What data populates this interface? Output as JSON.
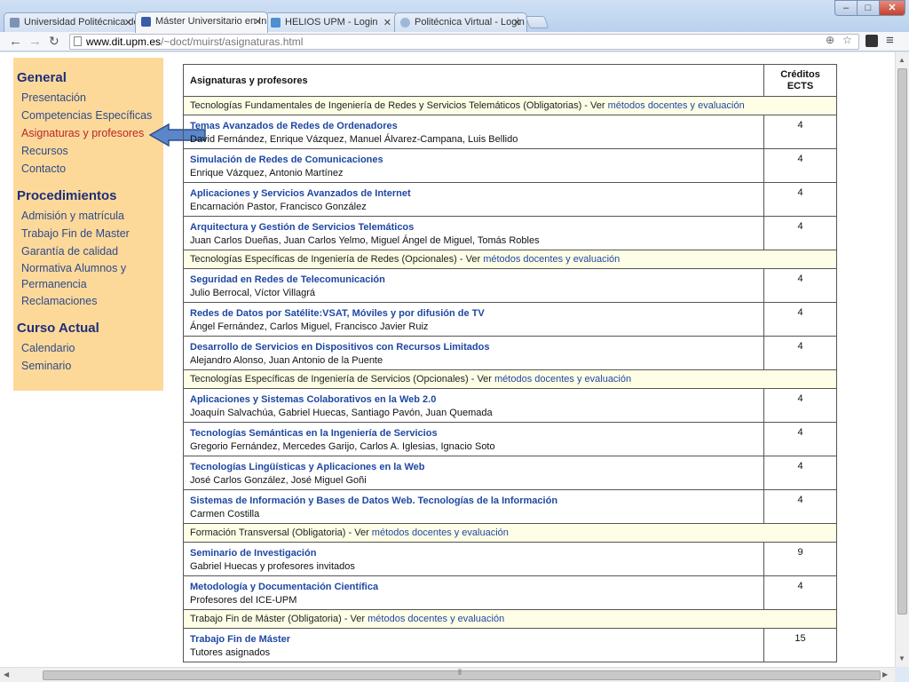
{
  "browser": {
    "tabs": [
      {
        "label": "Universidad Politécnica de",
        "active": false
      },
      {
        "label": "Máster Universitario en In",
        "active": true
      },
      {
        "label": "HELIOS UPM - Login",
        "active": false
      },
      {
        "label": "Politécnica Virtual - Login",
        "active": false
      }
    ],
    "url_host": "www.dit.upm.es",
    "url_path": "/~doct/muirst/asignaturas.html",
    "window_buttons": {
      "minimize": "–",
      "maximize": "□",
      "close": "✕"
    }
  },
  "sidebar": {
    "sections": [
      {
        "heading": "General",
        "items": [
          "Presentación",
          "Competencias Específicas",
          "Asignaturas y profesores",
          "Recursos",
          "Contacto"
        ]
      },
      {
        "heading": "Procedimientos",
        "items": [
          "Admisión y matrícula",
          "Trabajo Fin de Master",
          "Garantía de calidad",
          "Normativa Alumnos y Permanencia",
          "Reclamaciones"
        ]
      },
      {
        "heading": "Curso Actual",
        "items": [
          "Calendario",
          "Seminario"
        ]
      }
    ],
    "current_item": "Asignaturas y profesores"
  },
  "table": {
    "header_subjects": "Asignaturas y profesores",
    "header_credits_line1": "Créditos",
    "header_credits_line2": "ECTS",
    "sections": [
      {
        "title": "Tecnologías Fundamentales de Ingeniería de Redes y Servicios Telemáticos (Obligatorias) - Ver ",
        "link": "métodos docentes y evaluación",
        "courses": [
          {
            "name": "Temas Avanzados de Redes de Ordenadores",
            "profs": "David Fernández, Enrique Vázquez, Manuel Álvarez-Campana, Luis Bellido",
            "credits": "4"
          },
          {
            "name": "Simulación de Redes de Comunicaciones",
            "profs": "Enrique Vázquez, Antonio Martínez",
            "credits": "4"
          },
          {
            "name": "Aplicaciones y Servicios Avanzados de Internet",
            "profs": "Encarnación Pastor, Francisco González",
            "credits": "4"
          },
          {
            "name": "Arquitectura y Gestión de Servicios Telemáticos",
            "profs": "Juan Carlos Dueñas, Juan Carlos Yelmo, Miguel Ángel de Miguel, Tomás Robles",
            "credits": "4"
          }
        ]
      },
      {
        "title": "Tecnologías Específicas de Ingeniería de Redes (Opcionales) - Ver ",
        "link": "métodos docentes y evaluación",
        "courses": [
          {
            "name": "Seguridad en Redes de Telecomunicación",
            "profs": "Julio Berrocal, Víctor Villagrá",
            "credits": "4"
          },
          {
            "name": "Redes de Datos por Satélite:VSAT, Móviles y por difusión de TV",
            "profs": "Ángel Fernández, Carlos Miguel, Francisco Javier Ruiz",
            "credits": "4"
          },
          {
            "name": "Desarrollo de Servicios en Dispositivos con Recursos Limitados",
            "profs": "Alejandro Alonso, Juan Antonio de la Puente",
            "credits": "4"
          }
        ]
      },
      {
        "title": "Tecnologías Específicas de Ingeniería de Servicios (Opcionales) - Ver ",
        "link": "métodos docentes y evaluación",
        "courses": [
          {
            "name": "Aplicaciones y Sistemas Colaborativos en la Web 2.0",
            "profs": "Joaquín Salvachúa, Gabriel Huecas, Santiago Pavón, Juan Quemada",
            "credits": "4"
          },
          {
            "name": "Tecnologías Semánticas en la Ingeniería de Servicios",
            "profs": "Gregorio Fernández, Mercedes Garijo, Carlos A. Iglesias, Ignacio Soto",
            "credits": "4"
          },
          {
            "name": "Tecnologías Lingüísticas y Aplicaciones en la Web",
            "profs": "José Carlos González, José Miguel Goñi",
            "credits": "4"
          },
          {
            "name": "Sistemas de Información y Bases de Datos Web. Tecnologías de la Información",
            "profs": "Carmen Costilla",
            "credits": "4"
          }
        ]
      },
      {
        "title": "Formación Transversal (Obligatoria) - Ver ",
        "link": "métodos docentes y evaluación",
        "courses": [
          {
            "name": "Seminario de Investigación",
            "profs": "Gabriel Huecas y profesores invitados",
            "credits": "9"
          },
          {
            "name": "Metodología y Documentación Científica",
            "profs": "Profesores del ICE-UPM",
            "credits": "4"
          }
        ]
      },
      {
        "title": "Trabajo Fin de Máster (Obligatoria) - Ver ",
        "link": "métodos docentes y evaluación",
        "courses": [
          {
            "name": "Trabajo Fin de Máster",
            "profs": "Tutores asignados",
            "credits": "15"
          }
        ]
      }
    ]
  }
}
